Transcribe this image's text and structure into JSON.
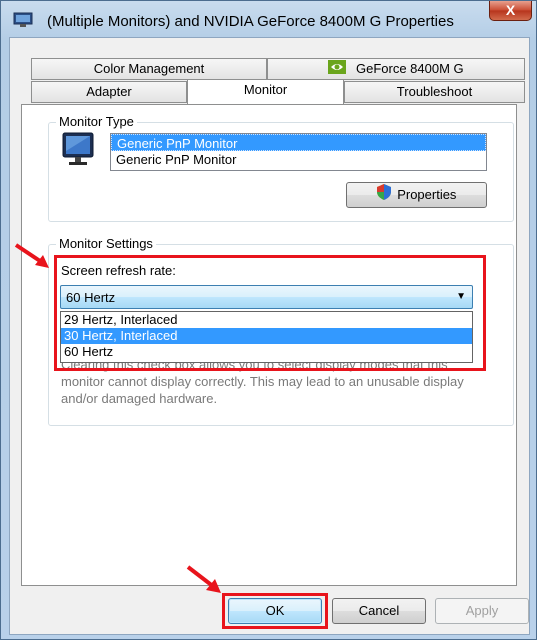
{
  "window": {
    "title": "(Multiple Monitors) and NVIDIA GeForce 8400M G  Properties",
    "close_label": "X"
  },
  "tabs": {
    "row1": [
      {
        "label": "Color Management"
      },
      {
        "label": "GeForce 8400M G",
        "icon": "nvidia-icon"
      }
    ],
    "row2": [
      {
        "label": "Adapter"
      },
      {
        "label": "Monitor",
        "active": true
      },
      {
        "label": "Troubleshoot"
      }
    ]
  },
  "monitor_type": {
    "group_label": "Monitor Type",
    "icon": "monitor-icon",
    "items": [
      {
        "label": "Generic PnP Monitor",
        "selected": true
      },
      {
        "label": "Generic PnP Monitor",
        "selected": false
      }
    ],
    "properties_button": "Properties",
    "properties_icon": "shield-icon"
  },
  "monitor_settings": {
    "group_label": "Monitor Settings",
    "refresh_label": "Screen refresh rate:",
    "refresh_value": "60 Hertz",
    "options": [
      {
        "label": "29 Hertz, Interlaced",
        "selected": false
      },
      {
        "label": "30 Hertz, Interlaced",
        "selected": true
      },
      {
        "label": "60 Hertz",
        "selected": false
      }
    ],
    "warning_line1": "Clearing this check box allows you to select display modes that this",
    "warning_line2": "monitor cannot display correctly. This may lead to an unusable display",
    "warning_line3": "and/or damaged hardware."
  },
  "buttons": {
    "ok": "OK",
    "cancel": "Cancel",
    "apply": "Apply"
  },
  "colors": {
    "highlight": "#e8141c",
    "selection": "#3399ff"
  }
}
